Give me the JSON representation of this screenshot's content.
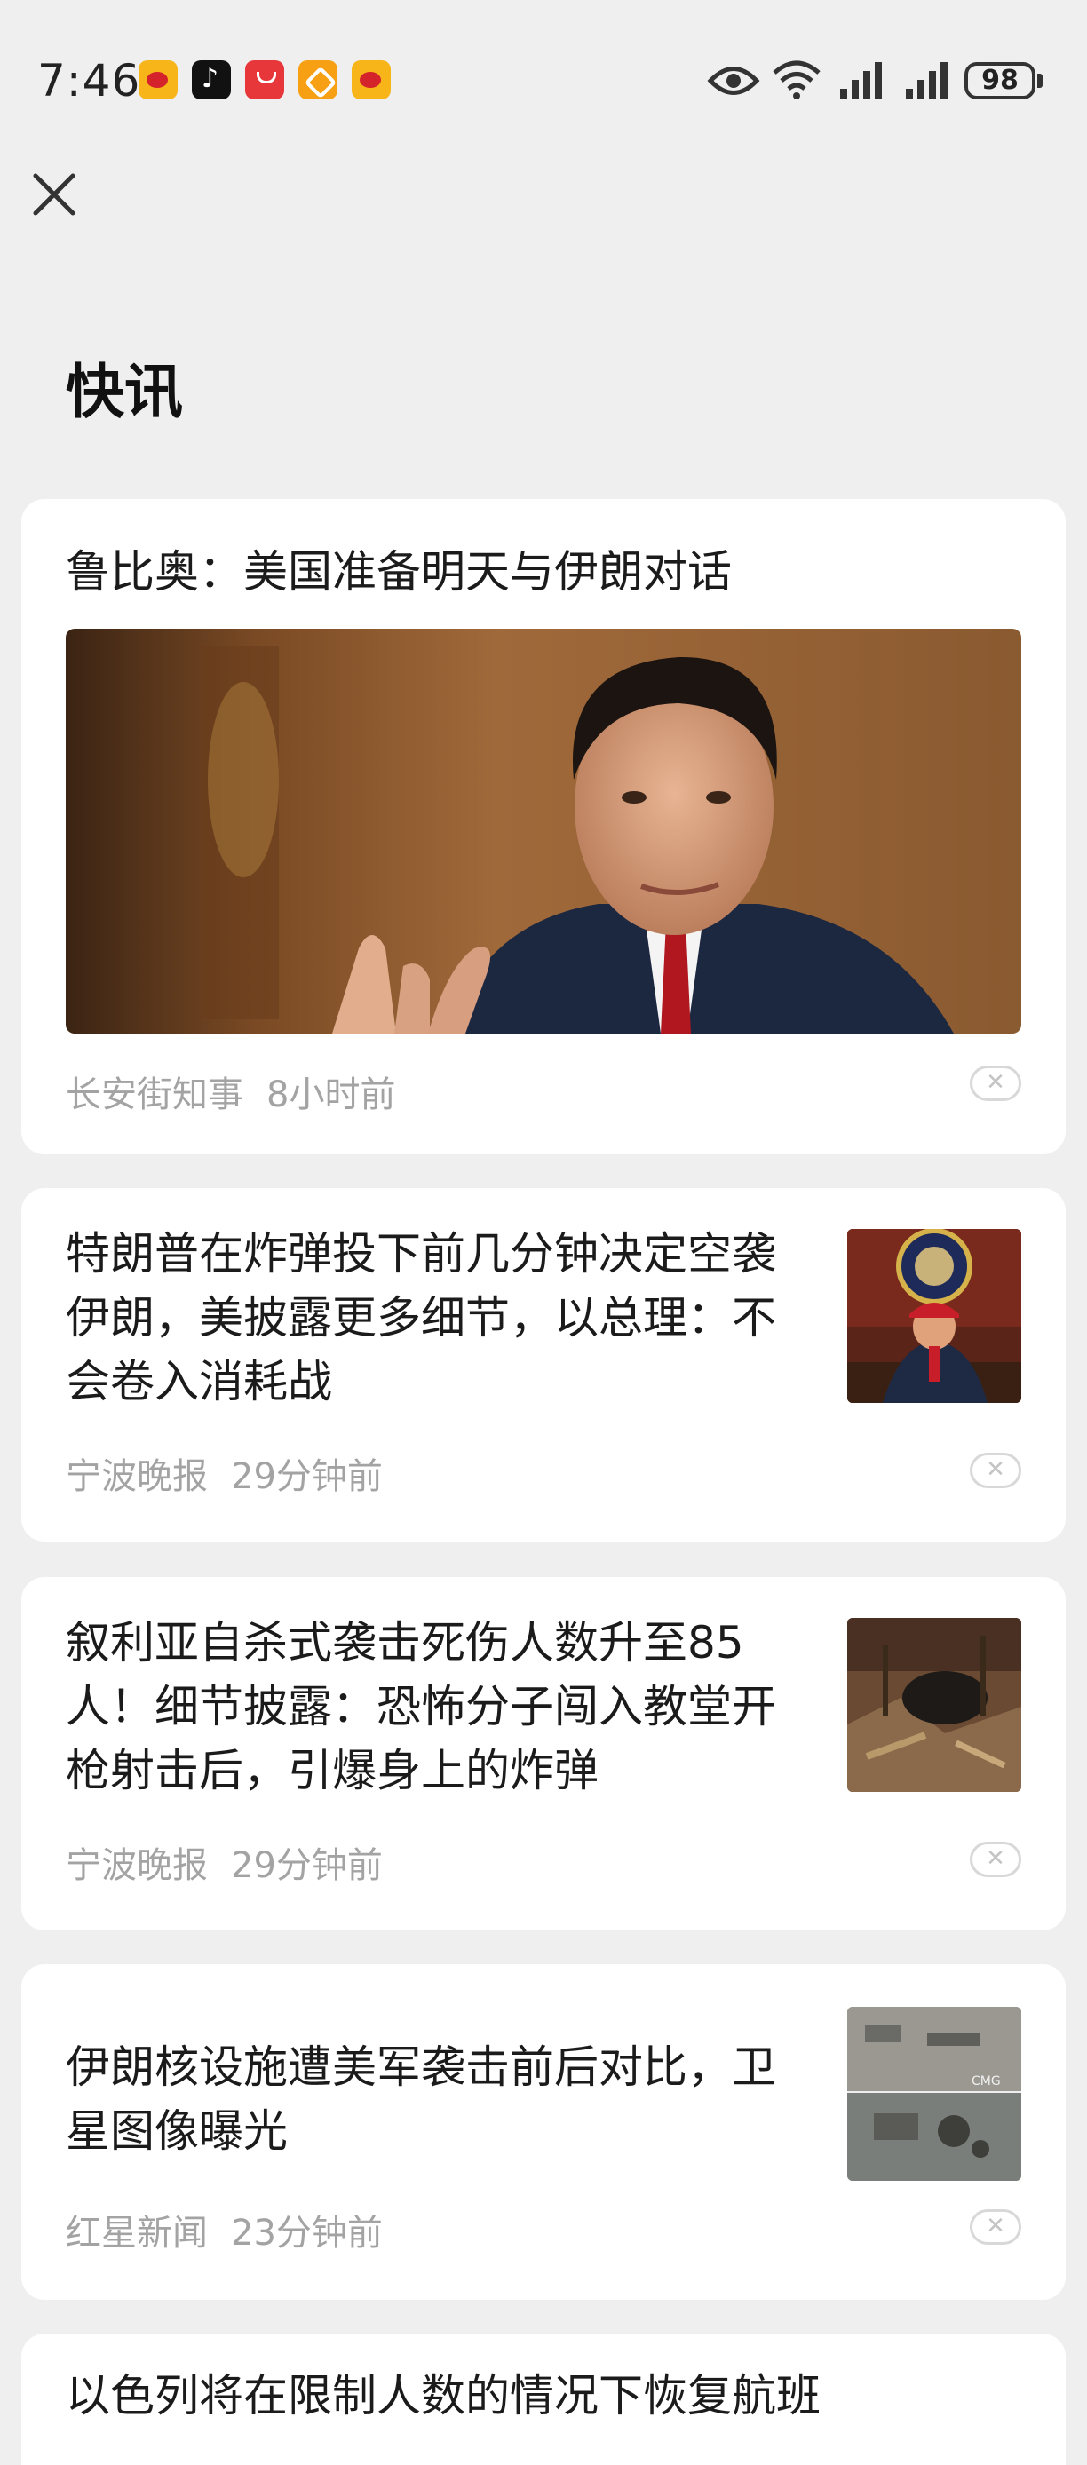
{
  "status_bar": {
    "time": "7:46",
    "battery": "98",
    "app_icons": [
      "weibo-icon",
      "tiktok-icon",
      "huawei-icon",
      "orange-app-icon",
      "weibo-icon"
    ],
    "system_icons": [
      "eye-icon",
      "wifi-icon",
      "signal-icon",
      "signal-icon",
      "battery-icon"
    ]
  },
  "header": {
    "close_icon": "close-icon",
    "title": "快讯"
  },
  "news": [
    {
      "title": "鲁比奥：美国准备明天与伊朗对话",
      "source": "长安街知事",
      "time": "8小时前",
      "image": "hero-photo"
    },
    {
      "title_lines": [
        "特朗普在炸弹投下前几分钟决定空袭",
        "伊朗，美披露更多细节，以总理：不",
        "会卷入消耗战"
      ],
      "source": "宁波晚报",
      "time": "29分钟前",
      "image": "thumbnail-photo"
    },
    {
      "title_lines": [
        "叙利亚自杀式袭击死伤人数升至85",
        "人！细节披露：恐怖分子闯入教堂开",
        "枪射击后，引爆身上的炸弹"
      ],
      "source": "宁波晚报",
      "time": "29分钟前",
      "image": "thumbnail-photo"
    },
    {
      "title_lines": [
        "伊朗核设施遭美军袭击前后对比，卫",
        "星图像曝光"
      ],
      "source": "红星新闻",
      "time": "23分钟前",
      "image": "satellite-thumbnail",
      "image_watermark": "CMG"
    },
    {
      "title": "以色列将在限制人数的情况下恢复航班"
    }
  ],
  "dismiss_label": "✕"
}
